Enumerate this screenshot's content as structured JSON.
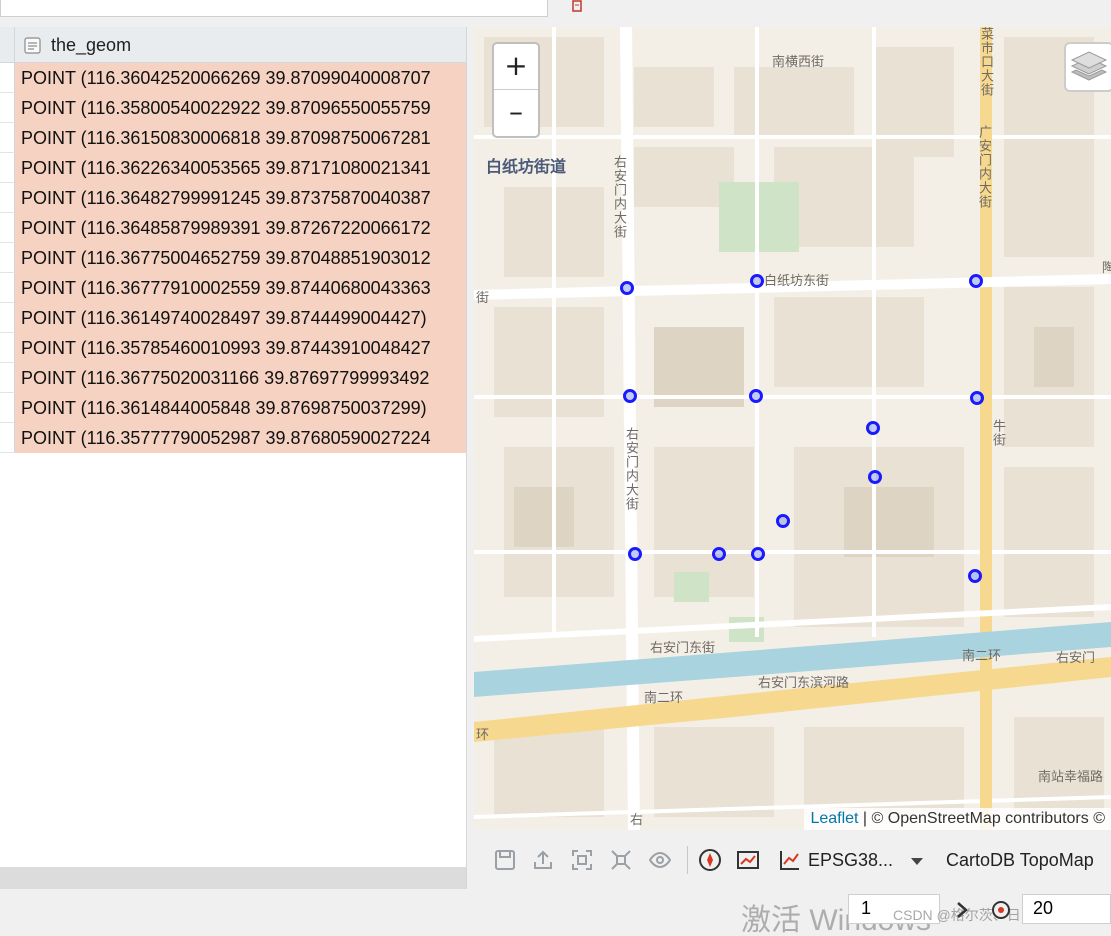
{
  "table": {
    "column_header": "the_geom",
    "rows": [
      "POINT (116.36042520066269 39.87099040008707",
      "POINT (116.35800540022922 39.87096550055759",
      "POINT (116.36150830006818 39.87098750067281",
      "POINT (116.36226340053565 39.87171080021341",
      "POINT (116.36482799991245 39.87375870040387",
      "POINT (116.36485879989391 39.87267220066172",
      "POINT (116.36775004652759 39.87048851903012",
      "POINT (116.36777910002559 39.87440680043363",
      "POINT (116.36149740028497 39.8744499004427)",
      "POINT (116.35785460010993 39.87443910048427",
      "POINT (116.36775020031166 39.87697799993492",
      "POINT (116.3614844005848 39.87698750037299)",
      "POINT (116.35777790052987 39.87680590027224"
    ]
  },
  "map": {
    "zoom_in": "+",
    "zoom_out": "–",
    "district": "白纸坊街道",
    "labels": {
      "nanheng": "南横西街",
      "caishikou": "菜市口大街",
      "guanganmen": "广安门内大街",
      "youanmen_n": "右安门内大街",
      "youanmen_s": "右安门内大街",
      "baizhifang": "白纸坊东街",
      "jie": "街",
      "niujie": "牛街",
      "youanmen_dong": "右安门东街",
      "nan2huan_w": "南二环",
      "nan2huan_e": "南二环",
      "binhe": "右安门东滨河路",
      "youan_right": "右安门",
      "huan": "环",
      "nanzhan": "南站幸福路",
      "you": "右",
      "yang": "陶"
    },
    "attribution_link": "Leaflet",
    "attribution_text": " | © OpenStreetMap contributors ©"
  },
  "toolbar": {
    "crs": "EPSG38...",
    "basemap": "CartoDB TopoMap"
  },
  "status": {
    "watermark": "激活 Windows",
    "sub_watermark": "CSDN @格尔茨、日出",
    "page": "1",
    "page_size": "20"
  }
}
